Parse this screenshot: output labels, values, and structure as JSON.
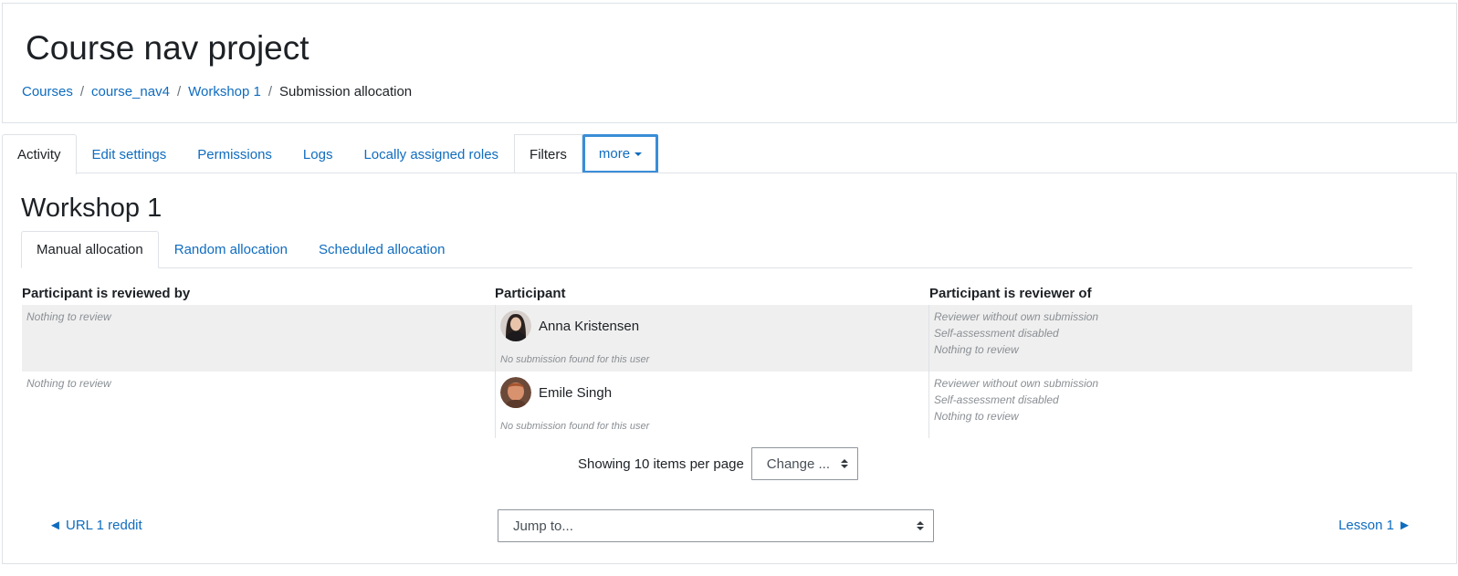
{
  "header": {
    "title": "Course nav project",
    "breadcrumb": [
      "Courses",
      "course_nav4",
      "Workshop 1",
      "Submission allocation"
    ]
  },
  "tabs": [
    {
      "label": "Activity"
    },
    {
      "label": "Edit settings"
    },
    {
      "label": "Permissions"
    },
    {
      "label": "Logs"
    },
    {
      "label": "Locally assigned roles"
    },
    {
      "label": "Filters"
    },
    {
      "label": "more"
    }
  ],
  "main": {
    "title": "Workshop 1",
    "subtabs": [
      "Manual allocation",
      "Random allocation",
      "Scheduled allocation"
    ],
    "table": {
      "headers": [
        "Participant is reviewed by",
        "Participant",
        "Participant is reviewer of"
      ],
      "rows": [
        {
          "reviewed_by": "Nothing to review",
          "name": "Anna Kristensen",
          "submission": "No submission found for this user",
          "reviewer_of": [
            "Reviewer without own submission",
            "Self-assessment disabled",
            "Nothing to review"
          ]
        },
        {
          "reviewed_by": "Nothing to review",
          "name": "Emile Singh",
          "submission": "No submission found for this user",
          "reviewer_of": [
            "Reviewer without own submission",
            "Self-assessment disabled",
            "Nothing to review"
          ]
        }
      ]
    },
    "perpage": {
      "label": "Showing 10 items per page",
      "button": "Change ..."
    },
    "nav": {
      "prev": "◄ URL 1 reddit",
      "jump": "Jump to...",
      "next": "Lesson 1 ►"
    }
  },
  "colors": {
    "link": "#0f6cbf",
    "focus": "#3a8dd8",
    "row_shade": "#efefef"
  }
}
